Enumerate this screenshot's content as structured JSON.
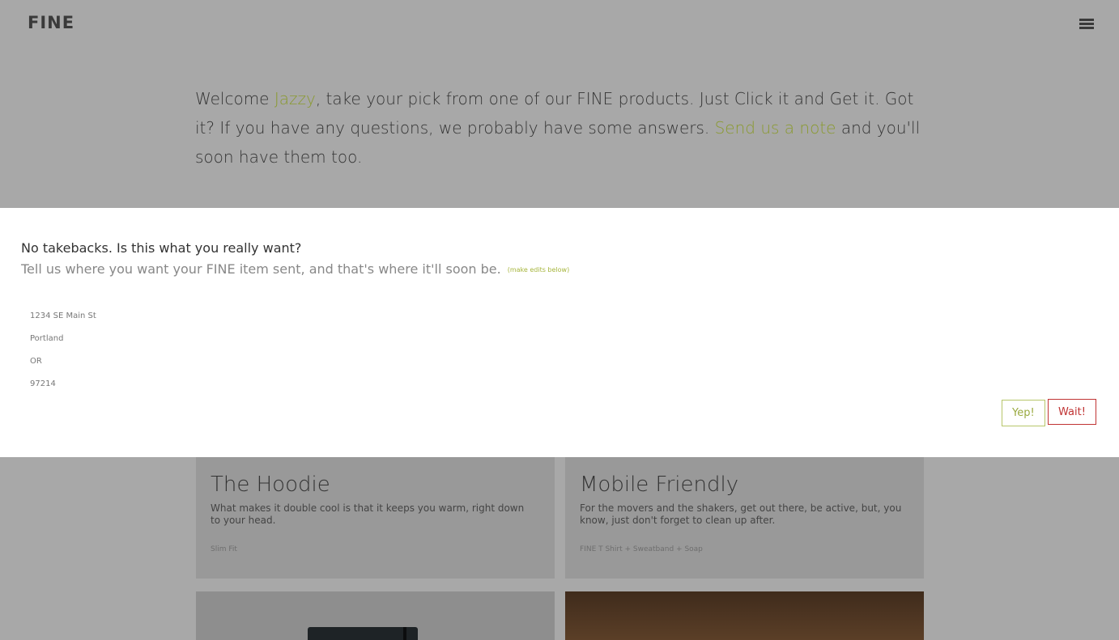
{
  "header": {
    "logo": "FINE",
    "menu_icon": "hamburger-menu-icon"
  },
  "intro": {
    "part1": "Welcome ",
    "user_name": "Jazzy",
    "part2": ", take your pick from one of our FINE products. Just Click it and Get it. Got it? If you have any questions, we probably have some answers. ",
    "note_link": "Send us a note",
    "part3": " and you'll soon have them too."
  },
  "products": [
    {
      "title": "The Hoodie",
      "description": "What makes it double cool is that it keeps you warm, right down to your head.",
      "meta": "Slim Fit"
    },
    {
      "title": "Mobile Friendly",
      "description": "For the movers and the shakers, get out there, be active, but, you know, just don't forget to clean up after.",
      "meta": "FINE T Shirt + Sweatband + Soap"
    }
  ],
  "modal": {
    "title": "No takebacks. Is this what you really want?",
    "subtitle": "Tell us where you want your FINE item sent, and that's where it'll soon be.",
    "edits_hint": "(make edits below)",
    "address": {
      "street": "1234 SE Main St",
      "city": "Portland",
      "state": "OR",
      "zip": "97214"
    },
    "confirm_label": "Yep!",
    "cancel_label": "Wait!"
  },
  "colors": {
    "accent_green": "#8a9a30",
    "cancel_red": "#c03333",
    "overlay_gray": "#a8a8a8"
  }
}
